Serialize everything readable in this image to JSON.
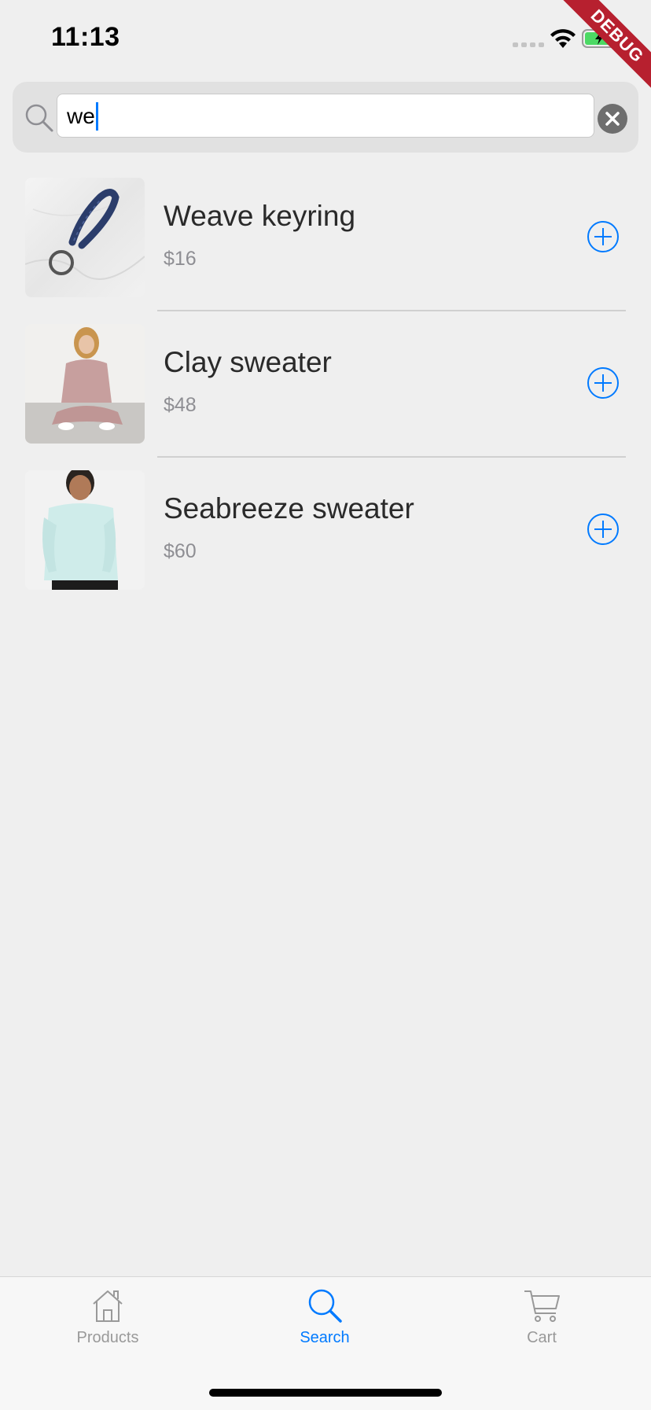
{
  "status_bar": {
    "time": "11:13"
  },
  "debug_banner": {
    "label": "DEBUG"
  },
  "search": {
    "value": "we",
    "icon": "search-icon",
    "clear_icon": "clear-icon"
  },
  "products": [
    {
      "name": "Weave keyring",
      "price": "$16",
      "image": "keyring-photo"
    },
    {
      "name": "Clay sweater",
      "price": "$48",
      "image": "clay-sweater-photo"
    },
    {
      "name": "Seabreeze sweater",
      "price": "$60",
      "image": "seabreeze-sweater-photo"
    }
  ],
  "tabs": [
    {
      "label": "Products",
      "icon": "home-icon",
      "active": false
    },
    {
      "label": "Search",
      "icon": "search-icon",
      "active": true
    },
    {
      "label": "Cart",
      "icon": "cart-icon",
      "active": false
    }
  ],
  "colors": {
    "accent": "#007aff",
    "inactive": "#999999",
    "background": "#efefef",
    "debug": "#b7202f",
    "battery": "#4cd964"
  }
}
